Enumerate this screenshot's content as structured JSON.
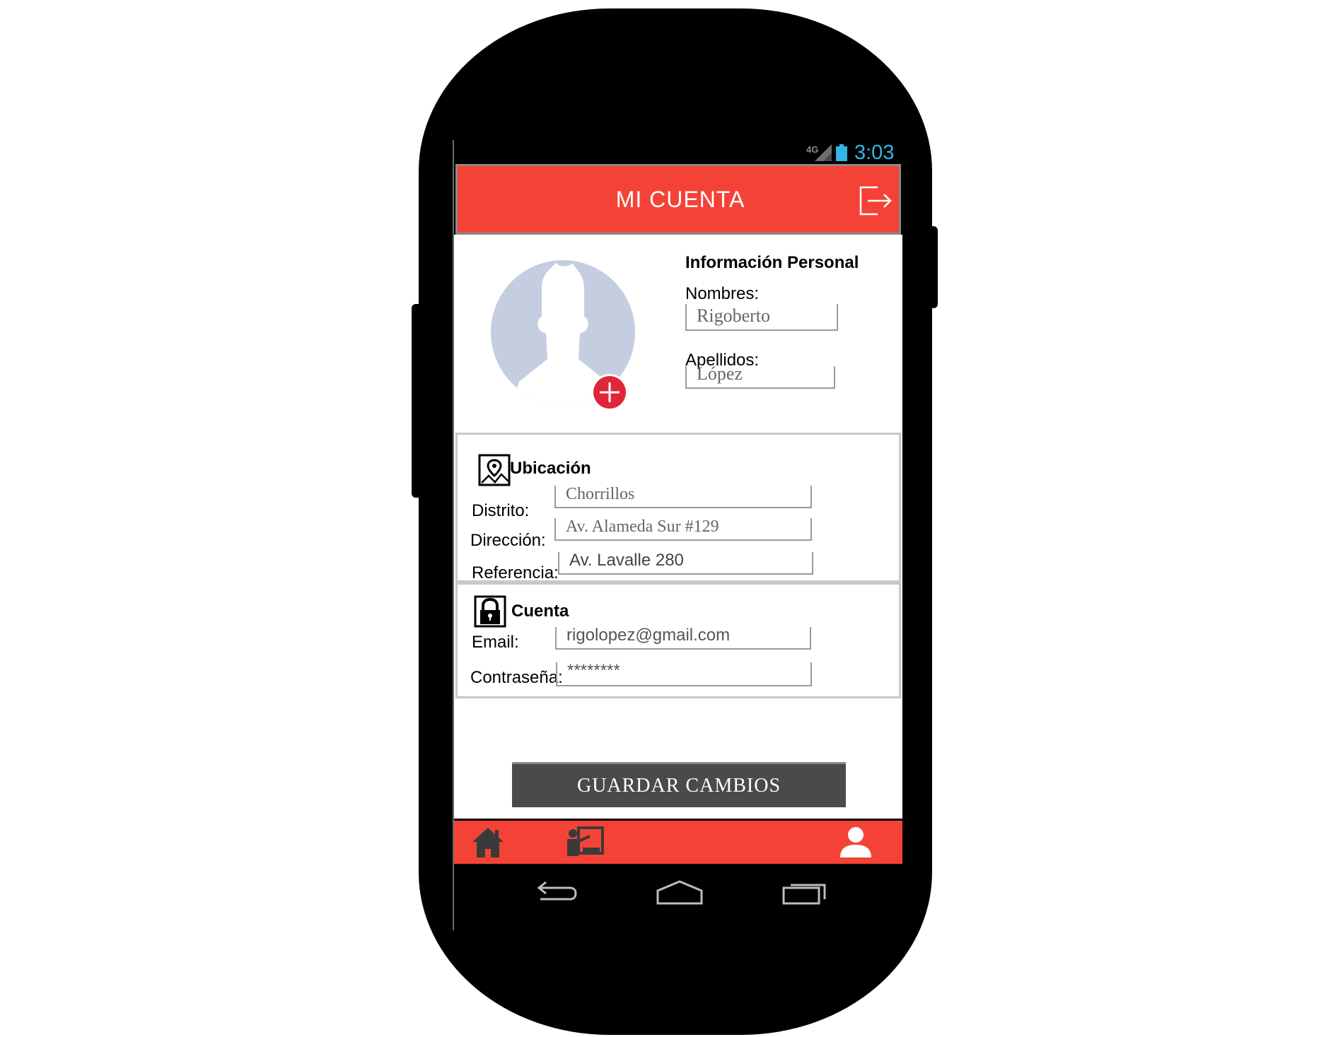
{
  "status": {
    "network": "4G",
    "time": "3:03"
  },
  "header": {
    "title": "MI CUENTA",
    "logout_icon": "logout-icon"
  },
  "personal": {
    "heading": "Información Personal",
    "first_name_label": "Nombres:",
    "first_name_value": "Rigoberto",
    "last_name_label": "Apellidos:",
    "last_name_value": "López"
  },
  "location": {
    "heading": "Ubicación",
    "district_label": "Distrito:",
    "district_value": "Chorrillos",
    "address_label": "Dirección:",
    "address_value": "Av. Alameda Sur #129",
    "reference_label": "Referencia:",
    "reference_value": "Av. Lavalle 280"
  },
  "account": {
    "heading": "Cuenta",
    "email_label": "Email:",
    "email_value": "rigolopez@gmail.com",
    "password_label": "Contraseña:",
    "password_value": "********"
  },
  "actions": {
    "save_label": "GUARDAR CAMBIOS"
  },
  "bottom_nav": [
    {
      "icon": "home-icon"
    },
    {
      "icon": "presentation-icon"
    },
    {
      "icon": "user-icon"
    }
  ],
  "colors": {
    "accent": "#f44336",
    "button": "#4a4a4a",
    "avatar": "#c5cde0",
    "add_badge": "#e0263b",
    "time": "#33b5e5"
  }
}
